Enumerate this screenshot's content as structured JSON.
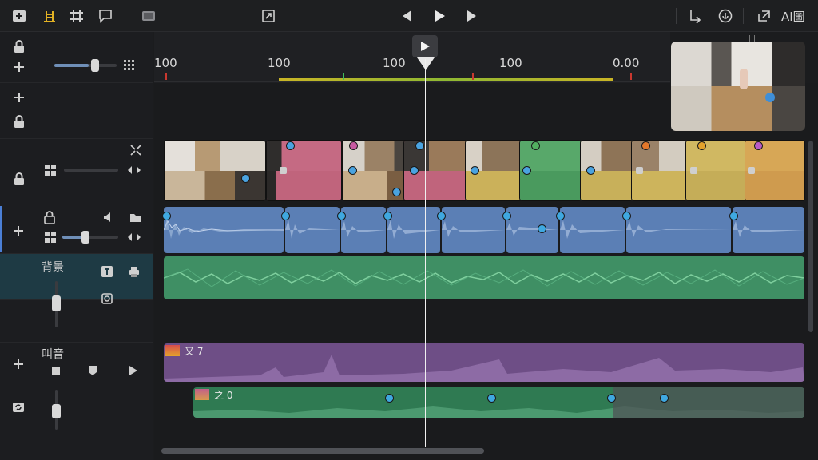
{
  "toolbar": {
    "ai_label": "AI圖"
  },
  "ruler": {
    "ticks": [
      "100",
      "100",
      "100",
      "100",
      "0.00"
    ]
  },
  "tracks": {
    "audio_label": "背景",
    "music_label": "叫音",
    "clip_a_name": "又 7",
    "clip_b_name": "之 0"
  },
  "colors": {
    "accent": "#e3b224",
    "video_blue": "#5b7fb5",
    "audio_green": "#3f8f64",
    "music_purple": "#6e4e86",
    "playhead": "#f0f0f0"
  },
  "levels": {
    "top_slider": 0.55,
    "video_slider": 0.0,
    "audio_slider": 0.4
  }
}
